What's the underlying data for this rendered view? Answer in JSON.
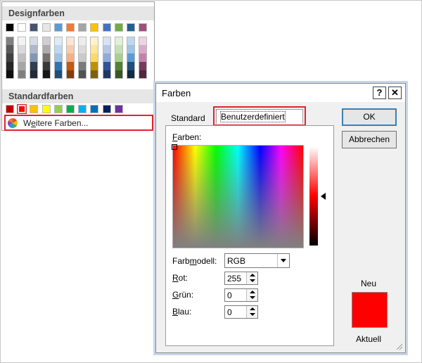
{
  "palette": {
    "theme_header": "Designfarben",
    "standard_header": "Standardfarben",
    "more_colors_prefix": "W",
    "more_colors_accel": "e",
    "more_colors_rest": "itere Farben...",
    "theme_top": [
      "#000000",
      "#ffffff",
      "#44546a",
      "#e7e6e6",
      "#5b9bd5",
      "#ed7d31",
      "#a5a5a5",
      "#ffc000",
      "#4472c4",
      "#70ad47",
      "#255e91",
      "#9e4f7c"
    ],
    "theme_tints": [
      [
        "#7f7f7f",
        "#595959",
        "#404040",
        "#262626",
        "#0d0d0d"
      ],
      [
        "#f2f2f2",
        "#d9d9d9",
        "#bfbfbf",
        "#a6a6a6",
        "#808080"
      ],
      [
        "#d6dce5",
        "#adb9ca",
        "#8497b0",
        "#333f50",
        "#222a35"
      ],
      [
        "#d0cece",
        "#aeabab",
        "#767171",
        "#3b3838",
        "#171616"
      ],
      [
        "#deebf7",
        "#bdd7ee",
        "#9dc3e6",
        "#2e75b6",
        "#1f4e79"
      ],
      [
        "#fbe5d6",
        "#f8cbad",
        "#f4b183",
        "#c55a11",
        "#843c0c"
      ],
      [
        "#ededed",
        "#dbdbdb",
        "#c9c9c9",
        "#7b7b7b",
        "#525252"
      ],
      [
        "#fff2cc",
        "#ffe699",
        "#ffd966",
        "#bf9000",
        "#7f6000"
      ],
      [
        "#dae3f3",
        "#b4c7e7",
        "#8faadc",
        "#2f5597",
        "#203864"
      ],
      [
        "#e2f0d9",
        "#c5e0b4",
        "#a9d18e",
        "#548235",
        "#385723"
      ],
      [
        "#bdd7ee",
        "#9dc3e6",
        "#5b9bd5",
        "#1f4e79",
        "#0f2b45"
      ],
      [
        "#ecd5e3",
        "#d9abc7",
        "#c681ab",
        "#763a5d",
        "#4f273e"
      ]
    ],
    "standard": [
      "#c00000",
      "#ff0000",
      "#ffc000",
      "#ffff00",
      "#92d050",
      "#00b050",
      "#00b0f0",
      "#0070c0",
      "#002060",
      "#7030a0"
    ],
    "standard_selected_index": 1
  },
  "dialog": {
    "title": "Farben",
    "help_label": "?",
    "close_label": "✕",
    "tab_standard": "Standard",
    "tab_custom": "Benutzerdefiniert",
    "ok_label": "OK",
    "cancel_label": "Abbrechen",
    "colors_label_accel": "F",
    "colors_label_rest": "arben:",
    "model_label_a": "Farb",
    "model_label_accel": "m",
    "model_label_b": "odell:",
    "model_value": "RGB",
    "red_label_accel": "R",
    "red_label_rest": "ot:",
    "red_value": "255",
    "green_label_accel": "G",
    "green_label_rest": "rün:",
    "green_value": "0",
    "blue_label_accel": "B",
    "blue_label_rest": "lau:",
    "blue_value": "0",
    "new_label": "Neu",
    "current_label": "Aktuell",
    "preview_color": "#ff0000"
  }
}
